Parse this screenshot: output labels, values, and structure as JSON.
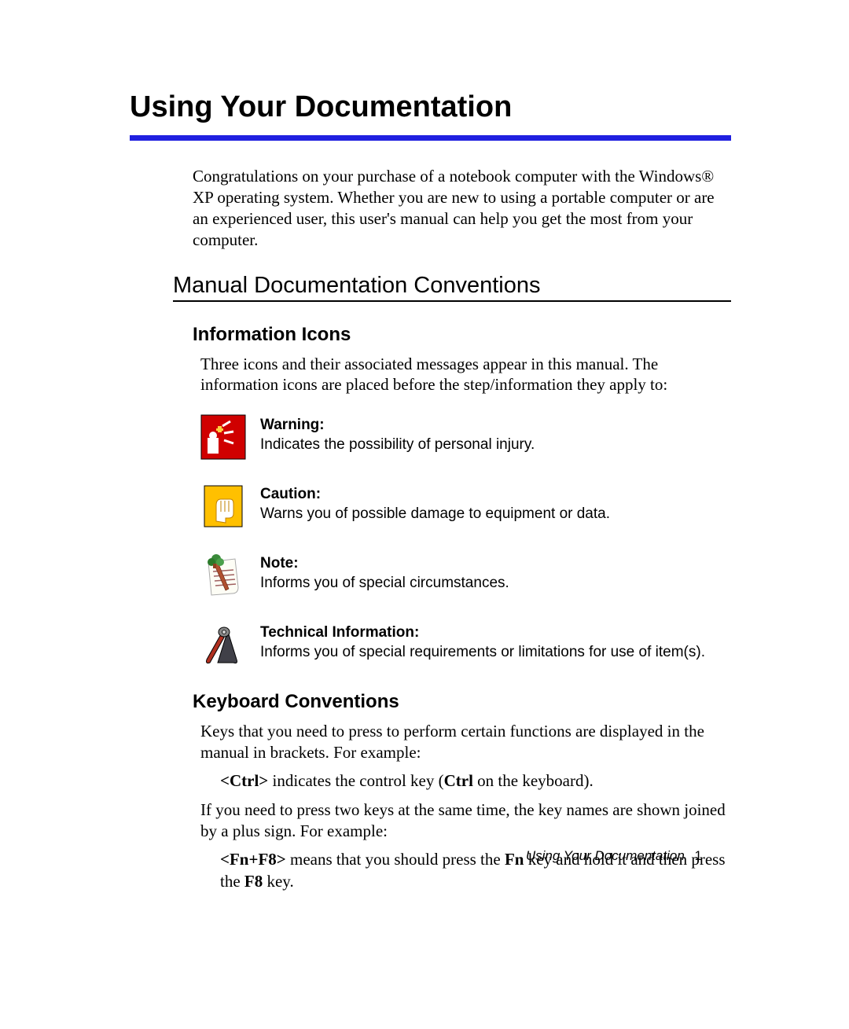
{
  "title": "Using Your Documentation",
  "intro": "Congratulations on your purchase of a notebook computer with the Windows® XP operating system. Whether you are new to using a portable computer or are an experienced user, this user's manual can help you get the most from your computer.",
  "section_title": "Manual Documentation Conventions",
  "info_icons": {
    "heading": "Information Icons",
    "intro": "Three icons and their associated messages appear in this manual. The information icons are placed before the step/information they apply to:",
    "items": [
      {
        "label": "Warning:",
        "desc": "Indicates the possibility of personal injury."
      },
      {
        "label": "Caution:",
        "desc": "Warns you of possible damage to equipment or data."
      },
      {
        "label": "Note:",
        "desc": "Informs you of special circumstances."
      },
      {
        "label": "Technical Information:",
        "desc": "Informs you of special requirements or limitations for use of item(s)."
      }
    ]
  },
  "keyboard": {
    "heading": "Keyboard Conventions",
    "p1": "Keys that you need to press to perform certain functions are displayed in the manual in brackets. For example:",
    "ex1_key": "<Ctrl>",
    "ex1_mid": " indicates the control key (",
    "ex1_bold": "Ctrl",
    "ex1_end": " on the keyboard).",
    "p2": "If you need to press two keys at the same time, the key names are shown joined by a plus sign. For example:",
    "ex2_key": "<Fn+F8>",
    "ex2_mid": " means that you should press the ",
    "ex2_b1": "Fn",
    "ex2_mid2": " key and hold it and then press the ",
    "ex2_b2": "F8",
    "ex2_end": " key."
  },
  "footer_title": "Using Your Documentation",
  "footer_page": "1"
}
